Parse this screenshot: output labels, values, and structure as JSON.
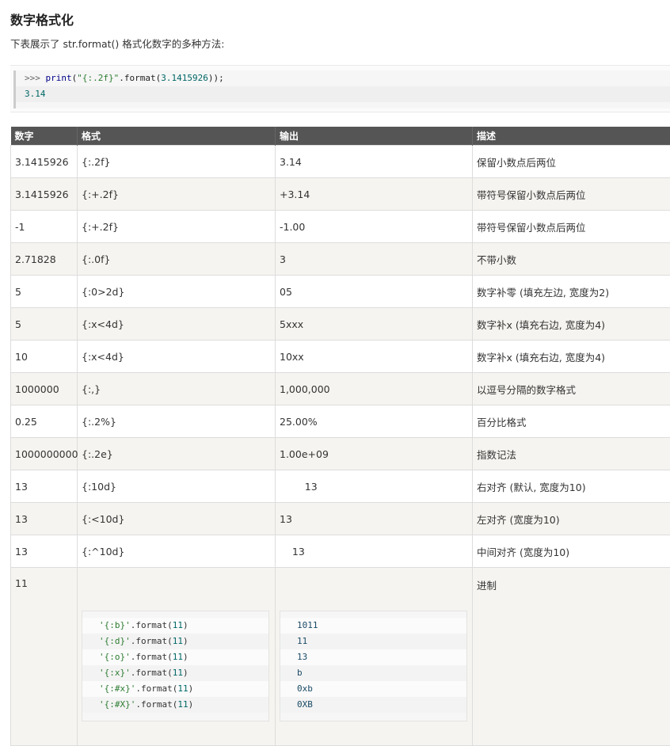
{
  "title": "数字格式化",
  "intro": "下表展示了 str.format() 格式化数字的多种方法:",
  "code": {
    "line1": {
      "prompt": ">>> ",
      "fn": "print",
      "open": "(",
      "str": "\"{:.2f}\"",
      "mid": ".format(",
      "num": "3.1415926",
      "close": "));"
    },
    "line2": "3.14"
  },
  "table": {
    "headers": [
      "数字",
      "格式",
      "输出",
      "描述"
    ],
    "rows": [
      [
        "3.1415926",
        "{:.2f}",
        "3.14",
        "保留小数点后两位"
      ],
      [
        "3.1415926",
        "{:+.2f}",
        "+3.14",
        "带符号保留小数点后两位"
      ],
      [
        "-1",
        "{:+.2f}",
        "-1.00",
        "带符号保留小数点后两位"
      ],
      [
        "2.71828",
        "{:.0f}",
        "3",
        "不带小数"
      ],
      [
        "5",
        "{:0>2d}",
        "05",
        "数字补零 (填充左边, 宽度为2)"
      ],
      [
        "5",
        "{:x<4d}",
        "5xxx",
        "数字补x (填充右边, 宽度为4)"
      ],
      [
        "10",
        "{:x<4d}",
        "10xx",
        "数字补x (填充右边, 宽度为4)"
      ],
      [
        "1000000",
        "{:,}",
        "1,000,000",
        "以逗号分隔的数字格式"
      ],
      [
        "0.25",
        "{:.2%}",
        "25.00%",
        "百分比格式"
      ],
      [
        "1000000000",
        "{:.2e}",
        "1.00e+09",
        "指数记法"
      ],
      [
        "13",
        "{:10d}",
        "        13",
        "右对齐 (默认, 宽度为10)"
      ],
      [
        "13",
        "{:<10d}",
        "13",
        "左对齐 (宽度为10)"
      ],
      [
        "13",
        "{:^10d}",
        "    13",
        "中间对齐 (宽度为10)"
      ]
    ],
    "last_row": {
      "number": "11",
      "description": "进制",
      "formats": [
        {
          "str": "'{:b}'",
          "mid": ".format(",
          "num": "11",
          "close": ")"
        },
        {
          "str": "'{:d}'",
          "mid": ".format(",
          "num": "11",
          "close": ")"
        },
        {
          "str": "'{:o}'",
          "mid": ".format(",
          "num": "11",
          "close": ")"
        },
        {
          "str": "'{:x}'",
          "mid": ".format(",
          "num": "11",
          "close": ")"
        },
        {
          "str": "'{:#x}'",
          "mid": ".format(",
          "num": "11",
          "close": ")"
        },
        {
          "str": "'{:#X}'",
          "mid": ".format(",
          "num": "11",
          "close": ")"
        }
      ],
      "outputs": [
        "1011",
        "11",
        "13",
        "b",
        "0xb",
        "0XB"
      ]
    }
  }
}
